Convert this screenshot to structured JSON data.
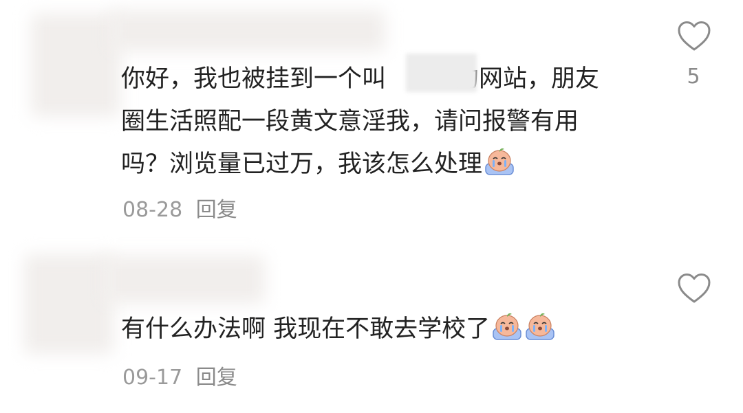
{
  "comments": [
    {
      "lines": [
        "你好，我也被挂到一个叫",
        "的网站，朋友",
        "圈生活照配一段黄文意淫我，请问报警有用",
        "吗？浏览量已过万，我该怎么处理"
      ],
      "emojis": [
        "crying-emoji"
      ],
      "date": "08-28",
      "reply_label": "回复",
      "like_count": "5"
    },
    {
      "lines": [
        "有什么办法啊 我现在不敢去学校了"
      ],
      "emojis": [
        "crying-emoji",
        "crying-emoji"
      ],
      "date": "09-17",
      "reply_label": "回复",
      "like_count": ""
    }
  ],
  "icons": {
    "like": "heart-outline-icon"
  },
  "colors": {
    "text": "#222222",
    "meta": "#9a9a9a",
    "icon": "#8a8a8a"
  }
}
